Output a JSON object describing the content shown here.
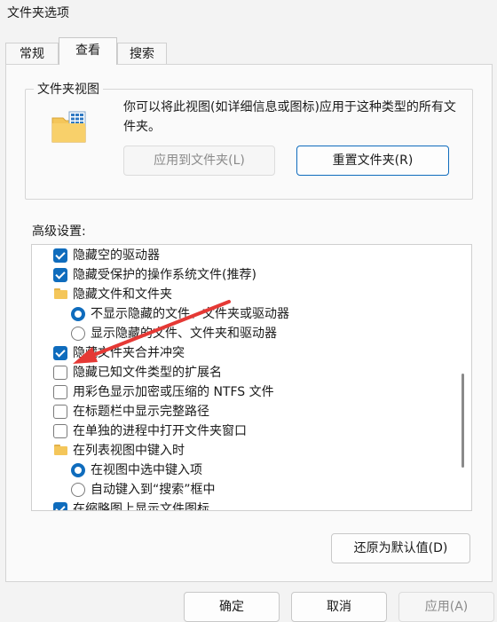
{
  "window": {
    "title": "文件夹选项"
  },
  "tabs": [
    {
      "label": "常规",
      "active": false
    },
    {
      "label": "查看",
      "active": true
    },
    {
      "label": "搜索",
      "active": false
    }
  ],
  "folder_views": {
    "legend": "文件夹视图",
    "description": "你可以将此视图(如详细信息或图标)应用于这种类型的所有文件夹。",
    "apply_label": "应用到文件夹(L)",
    "reset_label": "重置文件夹(R)"
  },
  "advanced": {
    "label": "高级设置:",
    "items": [
      {
        "type": "checkbox",
        "checked": true,
        "indent": 0,
        "label": "隐藏空的驱动器"
      },
      {
        "type": "checkbox",
        "checked": true,
        "indent": 0,
        "label": "隐藏受保护的操作系统文件(推荐)"
      },
      {
        "type": "folder",
        "checked": false,
        "indent": 0,
        "label": "隐藏文件和文件夹"
      },
      {
        "type": "radio",
        "checked": true,
        "indent": 1,
        "label": "不显示隐藏的文件、文件夹或驱动器"
      },
      {
        "type": "radio",
        "checked": false,
        "indent": 1,
        "label": "显示隐藏的文件、文件夹和驱动器"
      },
      {
        "type": "checkbox",
        "checked": true,
        "indent": 0,
        "label": "隐藏文件夹合并冲突"
      },
      {
        "type": "checkbox",
        "checked": false,
        "indent": 0,
        "label": "隐藏已知文件类型的扩展名"
      },
      {
        "type": "checkbox",
        "checked": false,
        "indent": 0,
        "label": "用彩色显示加密或压缩的 NTFS 文件"
      },
      {
        "type": "checkbox",
        "checked": false,
        "indent": 0,
        "label": "在标题栏中显示完整路径"
      },
      {
        "type": "checkbox",
        "checked": false,
        "indent": 0,
        "label": "在单独的进程中打开文件夹窗口"
      },
      {
        "type": "folder",
        "checked": false,
        "indent": 0,
        "label": "在列表视图中键入时"
      },
      {
        "type": "radio",
        "checked": true,
        "indent": 1,
        "label": "在视图中选中键入项"
      },
      {
        "type": "radio",
        "checked": false,
        "indent": 1,
        "label": "自动键入到“搜索”框中"
      },
      {
        "type": "checkbox",
        "checked": true,
        "indent": 0,
        "label": "在缩略图上显示文件图标"
      }
    ],
    "restore_label": "还原为默认值(D)"
  },
  "footer": {
    "ok_label": "确定",
    "cancel_label": "取消",
    "apply_label": "应用(A)"
  },
  "colors": {
    "accent": "#0f6cbd",
    "annotation_arrow": "#e53935"
  }
}
